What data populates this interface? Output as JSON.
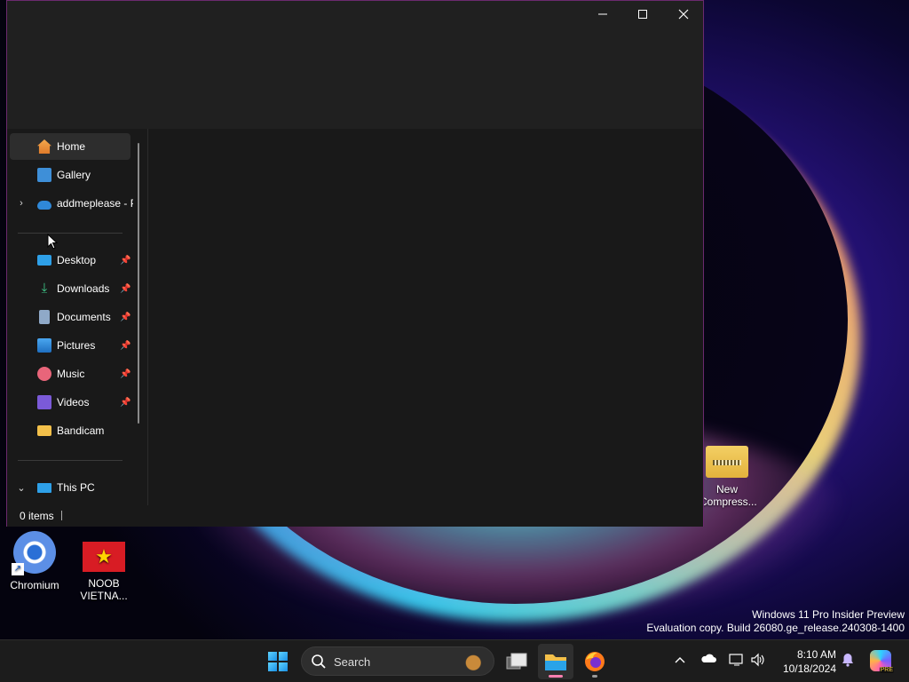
{
  "desktop": {
    "watermark_line1": "Windows 11 Pro Insider Preview",
    "watermark_line2": "Evaluation copy. Build 26080.ge_release.240308-1400",
    "icons": [
      {
        "label": "Chromium"
      },
      {
        "label": "NOOB VIETNA..."
      },
      {
        "label": "New Compress..."
      }
    ]
  },
  "window": {
    "controls": {
      "minimize": "minimize",
      "maximize": "maximize",
      "close": "close"
    },
    "nav": {
      "quick": [
        {
          "label": "Home",
          "icon": "home-icon",
          "selected": true
        },
        {
          "label": "Gallery",
          "icon": "gallery-icon"
        },
        {
          "label": "addmeplease - P",
          "icon": "onedrive-icon",
          "expandable": true
        }
      ],
      "pinned": [
        {
          "label": "Desktop",
          "icon": "desktop-icon",
          "pinned": true
        },
        {
          "label": "Downloads",
          "icon": "downloads-icon",
          "pinned": true
        },
        {
          "label": "Documents",
          "icon": "documents-icon",
          "pinned": true
        },
        {
          "label": "Pictures",
          "icon": "pictures-icon",
          "pinned": true
        },
        {
          "label": "Music",
          "icon": "music-icon",
          "pinned": true
        },
        {
          "label": "Videos",
          "icon": "videos-icon",
          "pinned": true
        },
        {
          "label": "Bandicam",
          "icon": "folder-icon",
          "pinned": false
        }
      ],
      "this_pc": {
        "label": "This PC",
        "icon": "this-pc-icon",
        "expanded": true
      }
    },
    "status": {
      "item_count": "0 items"
    }
  },
  "taskbar": {
    "search_placeholder": "Search",
    "apps": [
      {
        "name": "task-view",
        "icon": "task-view-icon"
      },
      {
        "name": "file-explorer",
        "icon": "file-explorer-icon",
        "active": true
      },
      {
        "name": "firefox",
        "icon": "firefox-icon"
      }
    ],
    "tray": {
      "time": "8:10 AM",
      "date": "10/18/2024"
    }
  },
  "colors": {
    "window_bg": "#191919",
    "titlebar_bg": "#202020",
    "window_border": "#6b2a6e",
    "taskbar_bg": "#1c1c1c",
    "active_indicator": "#ff7fb0"
  }
}
